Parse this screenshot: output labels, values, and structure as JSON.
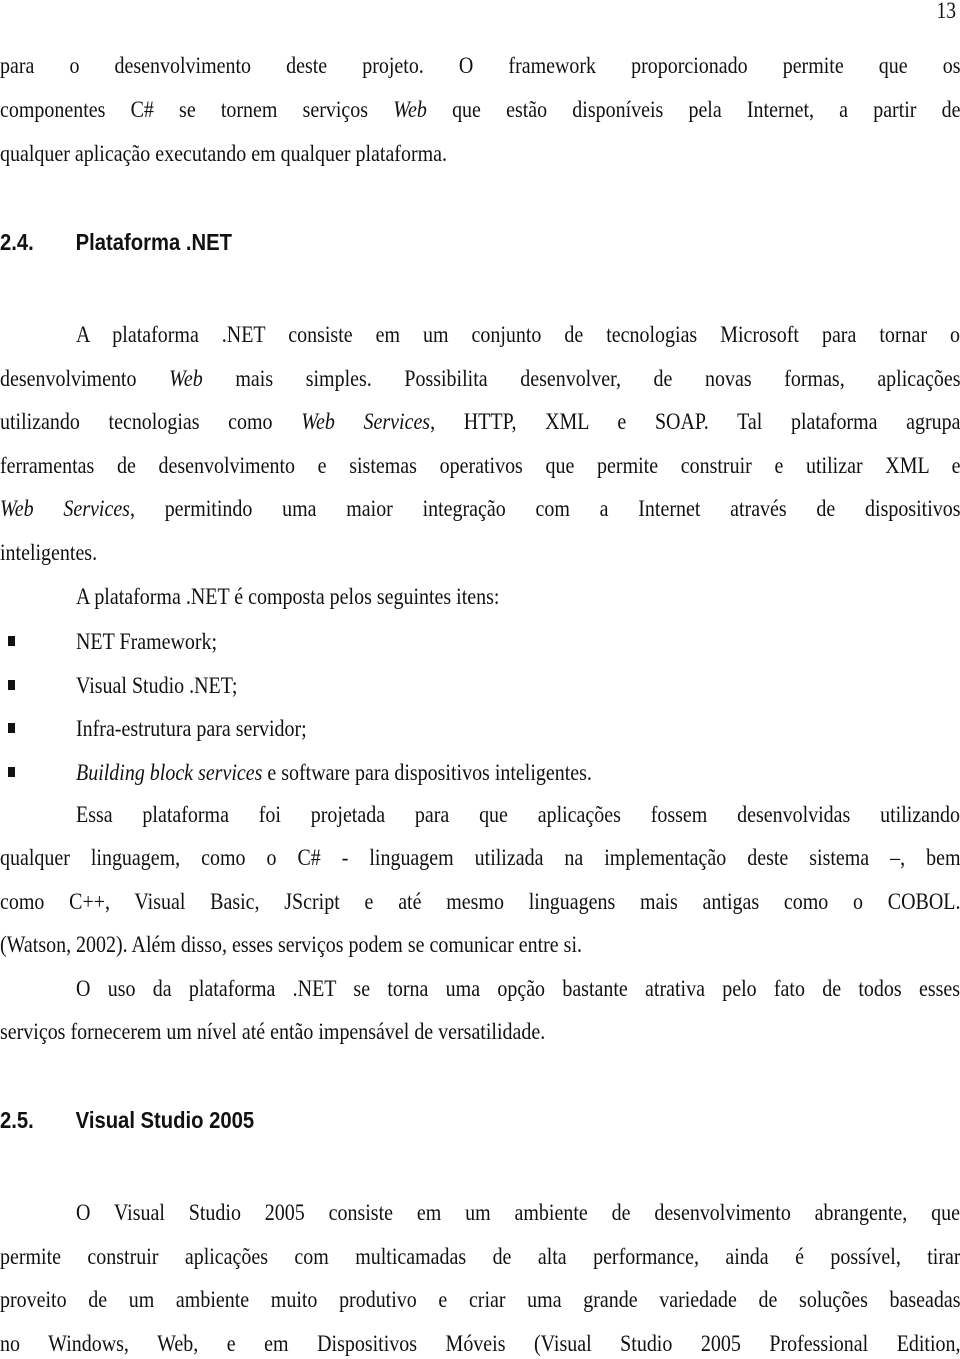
{
  "page": {
    "number": "13"
  },
  "continuation": {
    "lines": [
      "para o desenvolvimento deste projeto. O framework proporcionado permite que os",
      "componentes C# se tornem serviços |Web| que estão disponíveis pela Internet, a partir de",
      "qualquer aplicação executando em qualquer plataforma."
    ],
    "line1": "para o desenvolvimento deste projeto. O framework proporcionado permite que os",
    "line2_a": "componentes C# se tornem serviços ",
    "line2_b": "Web",
    "line2_c": " que estão disponíveis pela Internet, a partir de",
    "line3": "qualquer aplicação executando em qualquer plataforma."
  },
  "section_24": {
    "number": "2.4.",
    "title": "Plataforma .NET",
    "para1": {
      "l1": "A plataforma .NET consiste em um conjunto de tecnologias Microsoft para tornar o",
      "l2_a": "desenvolvimento ",
      "l2_b": "Web",
      "l2_c": " mais simples. Possibilita desenvolver, de novas formas, aplicações",
      "l3_a": "utilizando tecnologias como ",
      "l3_b": "Web Services",
      "l3_c": ", HTTP, XML e SOAP. Tal plataforma agrupa",
      "l4": "ferramentas de desenvolvimento e sistemas operativos que permite construir e utilizar XML e",
      "l5_a": "Web Services",
      "l5_b": ", permitindo uma maior integração com a Internet através de dispositivos",
      "l6": "inteligentes."
    },
    "list_intro": "A plataforma .NET é composta pelos seguintes itens:",
    "items": [
      {
        "italic": "",
        "text": "NET Framework;"
      },
      {
        "italic": "",
        "text": "Visual Studio .NET;"
      },
      {
        "italic": "",
        "text": "Infra-estrutura para servidor;"
      },
      {
        "italic": "Building block services",
        "text": " e software para dispositivos inteligentes."
      }
    ],
    "para2": {
      "l1": "Essa plataforma foi projetada para que aplicações fossem desenvolvidas utilizando",
      "l2": "qualquer linguagem, como o C# - linguagem utilizada na implementação deste sistema –, bem",
      "l3": "como C++, Visual Basic, JScript e até mesmo linguagens mais antigas como o COBOL.",
      "l4": "(Watson, 2002). Além disso, esses serviços podem se comunicar entre si."
    },
    "para3": {
      "l1": "O uso da plataforma .NET se torna uma opção bastante atrativa pelo fato de todos esses",
      "l2": "serviços fornecerem um nível até então impensável de versatilidade."
    }
  },
  "section_25": {
    "number": "2.5.",
    "title": "Visual Studio 2005",
    "para1": {
      "l1": "O Visual Studio 2005 consiste em um ambiente de desenvolvimento abrangente, que",
      "l2": "permite construir aplicações com multicamadas de alta performance, ainda é possível, tirar",
      "l3": "proveito de um ambiente muito produtivo e criar uma grande variedade de soluções baseadas",
      "l4": "no Windows, Web, e em Dispositivos Móveis (Visual Studio 2005 Professional Edition,"
    }
  }
}
